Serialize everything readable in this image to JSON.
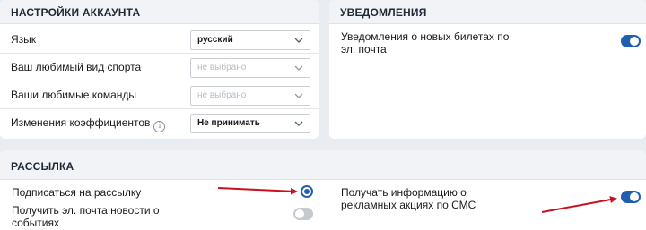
{
  "account_settings": {
    "title": "НАСТРОЙКИ АККАУНТА",
    "rows": [
      {
        "label": "Язык",
        "value": "русский"
      },
      {
        "label": "Ваш любимый вид спорта",
        "value": "не выбрано"
      },
      {
        "label": "Ваши любимые команды",
        "value": "не выбрано"
      },
      {
        "label": "Изменения коэффициентов",
        "value": "Не принимать"
      }
    ],
    "info_glyph": "i"
  },
  "notifications": {
    "title": "УВЕДОМЛЕНИЯ",
    "email_new_tickets": {
      "line1": "Уведомления о новых билетах по",
      "line2": "эл. почта",
      "enabled": true
    }
  },
  "newsletter": {
    "title": "РАССЫЛКА",
    "subscribe": {
      "label": "Подписаться на рассылку",
      "selected": true
    },
    "email_event_news": {
      "line1": "Получить эл. почта новости о",
      "line2": "событиях",
      "enabled": false
    },
    "sms_promos": {
      "line1": "Получать информацию о",
      "line2": "рекламных акциях по СМС",
      "enabled": true
    }
  },
  "colors": {
    "accent": "#1f5fad",
    "annotation_arrow": "#c8101e",
    "toggle_off": "#c6c9cd"
  },
  "icons": {
    "dropdown": "chevron-down-icon",
    "info": "info-icon",
    "annotation": "red-arrow-icon"
  }
}
